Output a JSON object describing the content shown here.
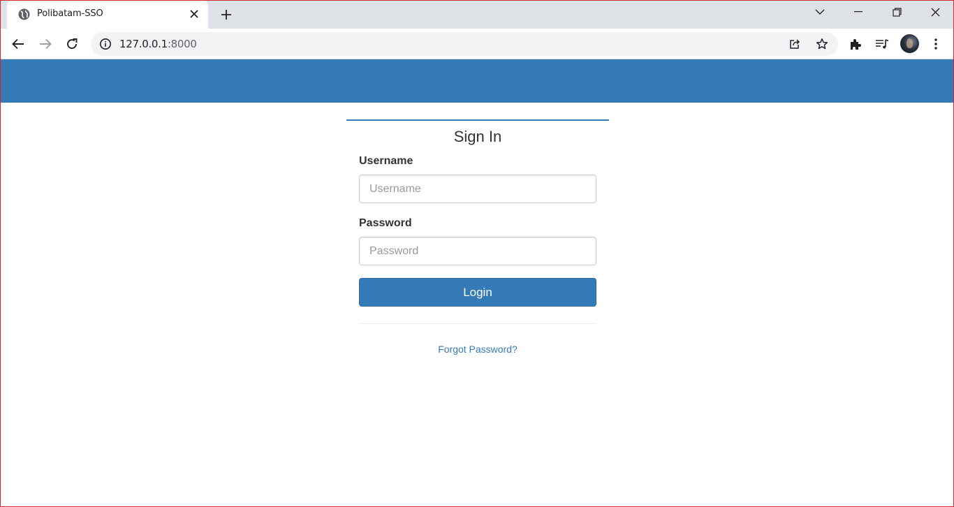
{
  "browser": {
    "tab": {
      "title": "Polibatam-SSO",
      "favicon": "globe-icon"
    },
    "url": {
      "host": "127.0.0.1",
      "port": ":8000"
    },
    "icons": [
      "back-icon",
      "forward-icon",
      "reload-icon",
      "info-icon",
      "share-icon",
      "star-icon",
      "extensions-icon",
      "media-icon",
      "menu-icon"
    ]
  },
  "colors": {
    "brand": "#337ab7",
    "tabstrip": "#dee1e6",
    "window_border": "#d3272b"
  },
  "signin": {
    "title": "Sign In",
    "username_label": "Username",
    "username_placeholder": "Username",
    "username_value": "",
    "password_label": "Password",
    "password_placeholder": "Password",
    "password_value": "",
    "login_label": "Login",
    "forgot_label": "Forgot Password?"
  }
}
